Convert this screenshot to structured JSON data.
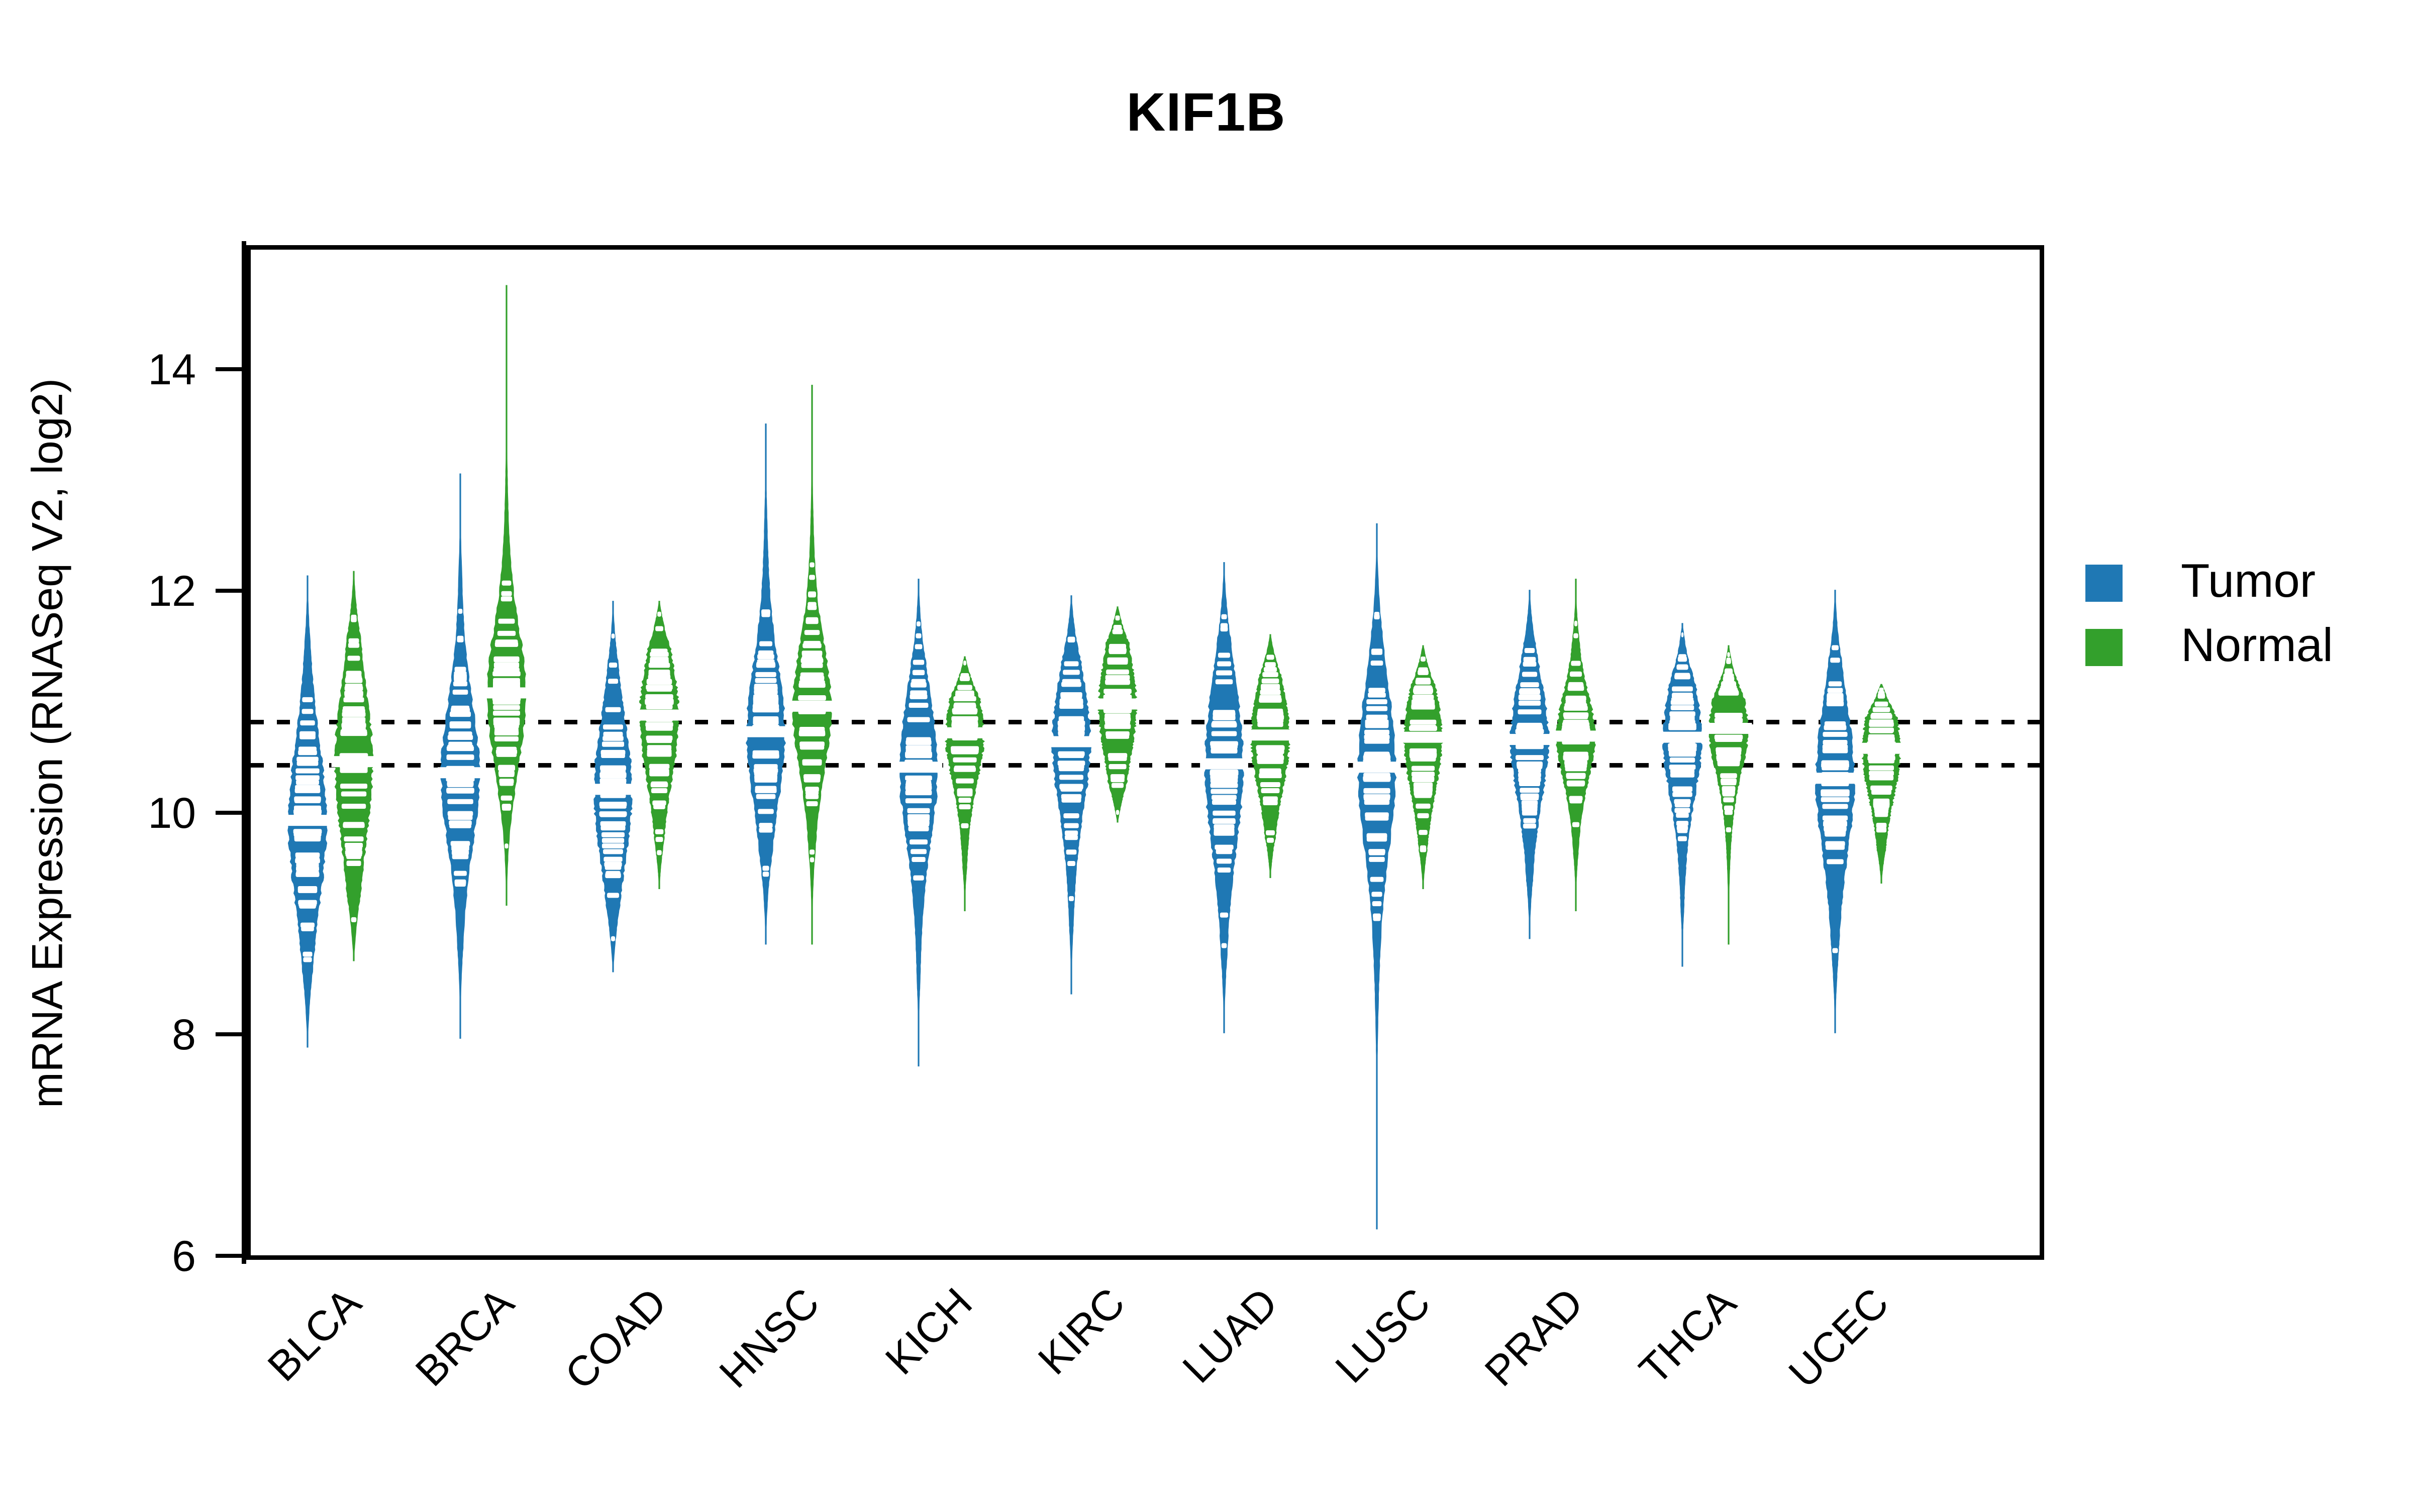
{
  "chart_data": {
    "type": "violin",
    "title": "KIF1B",
    "xlabel": "",
    "ylabel": "mRNA Expression (RNASeq V2, log2)",
    "ylim": [
      6,
      15.2
    ],
    "yticks": [
      6,
      8,
      10,
      12,
      14
    ],
    "ytick_labels": [
      "6",
      "8",
      "10",
      "12",
      "14"
    ],
    "grid": false,
    "legend_position": "right",
    "reference_lines": [
      10.86,
      10.47
    ],
    "categories": [
      "BLCA",
      "BRCA",
      "COAD",
      "HNSC",
      "KICH",
      "KIRC",
      "LUAD",
      "LUSC",
      "PRAD",
      "THCA",
      "UCEC"
    ],
    "series": [
      {
        "name": "Tumor",
        "color": "#1F78B4",
        "stats": [
          {
            "category": "BLCA",
            "median": 9.97,
            "q1": 9.55,
            "q3": 10.45,
            "min": 7.92,
            "max": 12.18
          },
          {
            "category": "BRCA",
            "median": 10.4,
            "q1": 10.0,
            "q3": 10.8,
            "min": 8.0,
            "max": 13.1
          },
          {
            "category": "COAD",
            "median": 10.25,
            "q1": 9.9,
            "q3": 10.7,
            "min": 8.6,
            "max": 11.95
          },
          {
            "category": "HNSC",
            "median": 10.77,
            "q1": 10.35,
            "q3": 11.15,
            "min": 8.85,
            "max": 13.55
          },
          {
            "category": "KICH",
            "median": 10.45,
            "q1": 10.05,
            "q3": 10.85,
            "min": 7.75,
            "max": 12.15
          },
          {
            "category": "KIRC",
            "median": 10.68,
            "q1": 10.3,
            "q3": 11.05,
            "min": 8.4,
            "max": 12.0
          },
          {
            "category": "LUAD",
            "median": 10.48,
            "q1": 10.0,
            "q3": 10.9,
            "min": 8.05,
            "max": 12.3
          },
          {
            "category": "LUSC",
            "median": 10.45,
            "q1": 10.0,
            "q3": 10.9,
            "min": 6.28,
            "max": 12.65
          },
          {
            "category": "PRAD",
            "median": 10.7,
            "q1": 10.38,
            "q3": 11.05,
            "min": 8.9,
            "max": 12.05
          },
          {
            "category": "THCA",
            "median": 10.72,
            "q1": 10.4,
            "q3": 11.05,
            "min": 8.65,
            "max": 11.75
          },
          {
            "category": "UCEC",
            "median": 10.35,
            "q1": 9.9,
            "q3": 10.75,
            "min": 8.05,
            "max": 12.05
          }
        ]
      },
      {
        "name": "Normal",
        "color": "#33A02C",
        "stats": [
          {
            "category": "BLCA",
            "median": 10.5,
            "q1": 10.15,
            "q3": 11.05,
            "min": 8.7,
            "max": 12.22
          },
          {
            "category": "BRCA",
            "median": 11.12,
            "q1": 10.75,
            "q3": 11.5,
            "min": 9.2,
            "max": 14.8
          },
          {
            "category": "COAD",
            "median": 10.92,
            "q1": 10.6,
            "q3": 11.3,
            "min": 9.35,
            "max": 11.95
          },
          {
            "category": "HNSC",
            "median": 11.0,
            "q1": 10.7,
            "q3": 11.4,
            "min": 8.85,
            "max": 13.9
          },
          {
            "category": "KICH",
            "median": 10.76,
            "q1": 10.5,
            "q3": 11.05,
            "min": 9.15,
            "max": 11.45
          },
          {
            "category": "KIRC",
            "median": 11.02,
            "q1": 10.7,
            "q3": 11.35,
            "min": 9.95,
            "max": 11.9
          },
          {
            "category": "LUAD",
            "median": 10.74,
            "q1": 10.45,
            "q3": 11.05,
            "min": 9.45,
            "max": 11.65
          },
          {
            "category": "LUSC",
            "median": 10.72,
            "q1": 10.45,
            "q3": 11.05,
            "min": 9.35,
            "max": 11.55
          },
          {
            "category": "PRAD",
            "median": 10.73,
            "q1": 10.5,
            "q3": 11.0,
            "min": 9.15,
            "max": 12.15
          },
          {
            "category": "THCA",
            "median": 10.8,
            "q1": 10.55,
            "q3": 11.05,
            "min": 8.85,
            "max": 11.55
          },
          {
            "category": "UCEC",
            "median": 10.62,
            "q1": 10.35,
            "q3": 10.9,
            "min": 9.4,
            "max": 11.2
          }
        ]
      }
    ]
  },
  "title": {
    "text": "KIF1B"
  },
  "axes": {
    "y_title": "mRNA Expression (RNASeq V2, log2)",
    "y_ticks": [
      "14",
      "12",
      "10",
      "8",
      "6"
    ],
    "x_ticks": [
      "BLCA",
      "BRCA",
      "COAD",
      "HNSC",
      "KICH",
      "KIRC",
      "LUAD",
      "LUSC",
      "PRAD",
      "THCA",
      "UCEC"
    ]
  },
  "legend": {
    "items": [
      {
        "label": "Tumor",
        "color": "#1F78B4"
      },
      {
        "label": "Normal",
        "color": "#33A02C"
      }
    ]
  }
}
